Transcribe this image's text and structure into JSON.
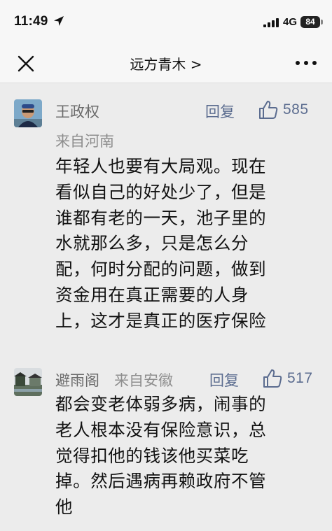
{
  "status_bar": {
    "time": "11:49",
    "network": "4G",
    "battery": "84"
  },
  "nav": {
    "title": "远方青木 >"
  },
  "comments": [
    {
      "user": "王政权",
      "origin": "来自河南",
      "reply_label": "回复",
      "likes": "585",
      "lines": [
        "年轻人也要有大局观。现在",
        "看似自己的好处少了，但是",
        "谁都有老的一天，池子里的",
        "水就那么多，只是怎么分",
        "配，何时分配的问题，做到",
        "资金用在真正需要的人身",
        "上，这才是真正的医疗保险"
      ]
    },
    {
      "user": "避雨阁",
      "origin": "来自安徽",
      "reply_label": "回复",
      "likes": "517",
      "lines": [
        "都会变老体弱多病，闹事的",
        "老人根本没有保险意识，总",
        "觉得扣他的钱该他买菜吃",
        "掉。然后遇病再赖政府不管",
        "他"
      ]
    }
  ]
}
